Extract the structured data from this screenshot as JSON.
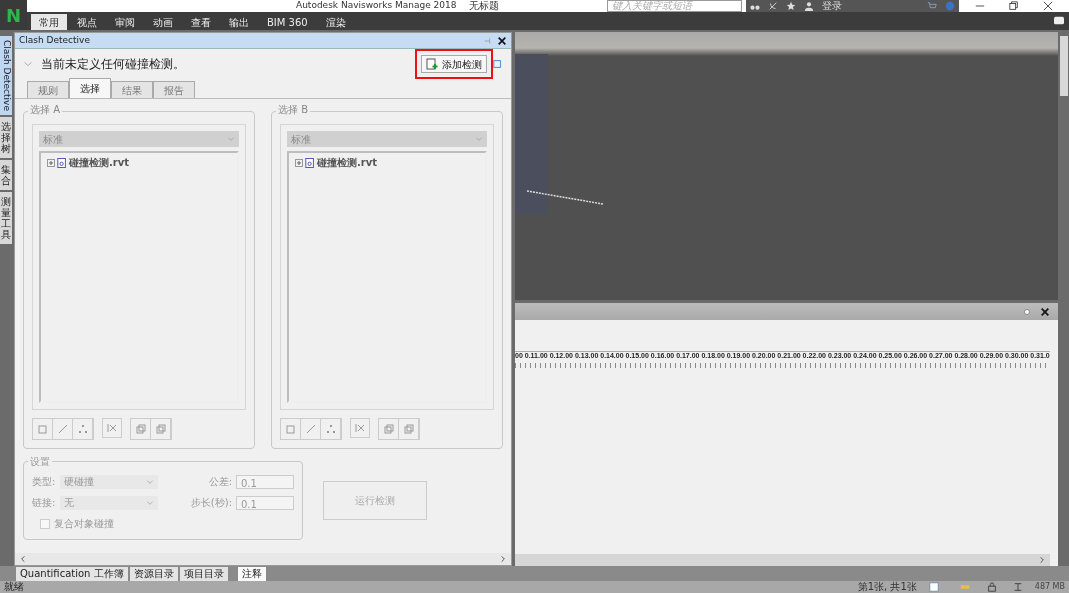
{
  "window": {
    "logo": "N",
    "title": "Autodesk Navisworks Manage 2018",
    "document": "无标题",
    "search": {
      "placeholder": "键入关键字或短语"
    },
    "login": "登录"
  },
  "ribbon_tabs": [
    {
      "label": "常用",
      "selected": true
    },
    {
      "label": "视点",
      "selected": false
    },
    {
      "label": "审阅",
      "selected": false
    },
    {
      "label": "动画",
      "selected": false
    },
    {
      "label": "查看",
      "selected": false
    },
    {
      "label": "输出",
      "selected": false
    },
    {
      "label": "BIM 360",
      "selected": false
    },
    {
      "label": "渲染",
      "selected": false
    }
  ],
  "side_tabs": [
    {
      "label": "Clash Detective",
      "kind": "latin",
      "selected": true
    },
    {
      "label": "选择树",
      "kind": "cjk",
      "selected": false
    },
    {
      "label": "集合",
      "kind": "cjk",
      "selected": false
    },
    {
      "label": "测量工具",
      "kind": "cjk",
      "selected": false
    }
  ],
  "clash_panel": {
    "title": "Clash Detective",
    "message": "当前未定义任何碰撞检测。",
    "add_button": "添加检测",
    "tabs": [
      {
        "label": "规则",
        "selected": false
      },
      {
        "label": "选择",
        "selected": true
      },
      {
        "label": "结果",
        "selected": false
      },
      {
        "label": "报告",
        "selected": false
      }
    ],
    "selections": [
      {
        "title": "选择 A",
        "mode": "标准",
        "tree": [
          {
            "label": "碰撞检测.rvt",
            "expanded": false
          }
        ]
      },
      {
        "title": "选择 B",
        "mode": "标准",
        "tree": [
          {
            "label": "碰撞检测.rvt",
            "expanded": false
          }
        ]
      }
    ],
    "settings": {
      "title": "设置",
      "type_label": "类型:",
      "type_value": "硬碰撞",
      "tolerance_label": "公差:",
      "tolerance_value": "0.1",
      "link_label": "链接:",
      "link_value": "无",
      "step_label": "步长(秒):",
      "step_value": "0.1",
      "composite": {
        "label": "复合对象碰撞",
        "checked": false
      }
    },
    "run_button": {
      "label": "运行检测",
      "disabled": true
    }
  },
  "timeline": {
    "ticks": [
      "00",
      "0.11.00",
      "0.12.00",
      "0.13.00",
      "0.14.00",
      "0.15.00",
      "0.16.00",
      "0.17.00",
      "0.18.00",
      "0.19.00",
      "0.20.00",
      "0.21.00",
      "0.22.00",
      "0.23.00",
      "0.24.00",
      "0.25.00",
      "0.26.00",
      "0.27.00",
      "0.28.00",
      "0.29.00",
      "0.30.00",
      "0.31.0"
    ]
  },
  "bottom_tabs": [
    {
      "label": "Quantification 工作簿",
      "selected": false
    },
    {
      "label": "资源目录",
      "selected": false
    },
    {
      "label": "项目目录",
      "selected": false
    },
    {
      "label": "注释",
      "selected": true
    }
  ],
  "status_bar": {
    "status": "就绪",
    "sheet": "第1张, 共1张",
    "memory": "487 MB"
  }
}
